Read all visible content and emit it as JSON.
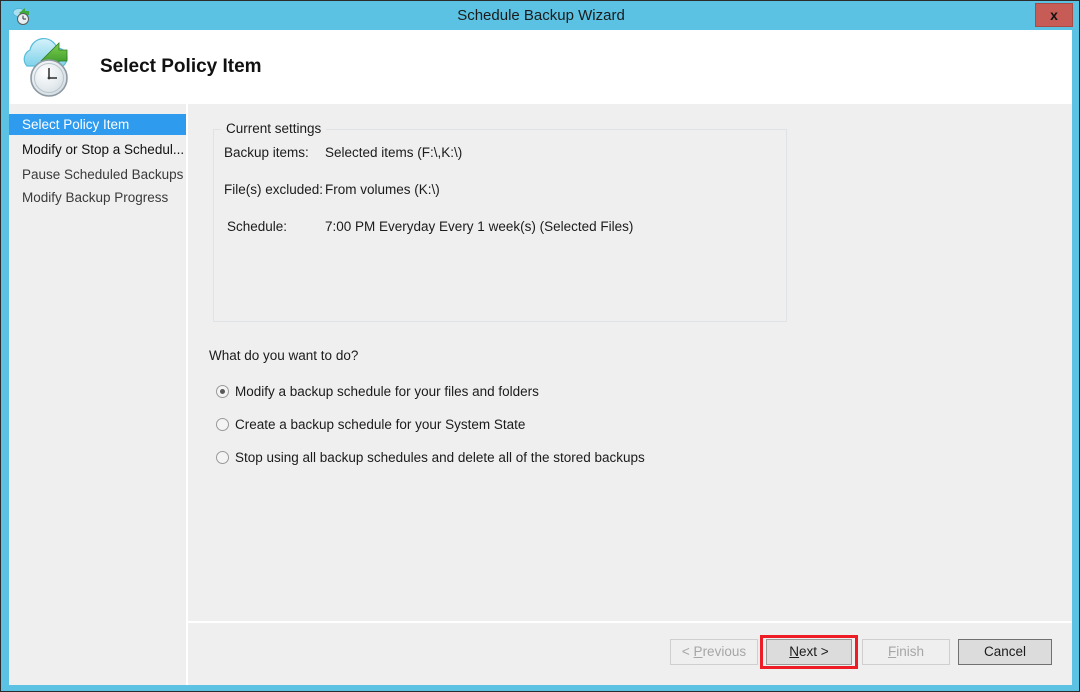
{
  "window": {
    "title": "Schedule Backup Wizard",
    "close_label": "x",
    "titlebar_color": "#5bc2e3",
    "close_color": "#c75b55"
  },
  "header": {
    "title": "Select Policy Item",
    "icon": "cloud-backup-clock-icon"
  },
  "sidebar": {
    "items": [
      {
        "label": "Select Policy Item",
        "selected": true
      },
      {
        "label": "Modify or Stop a Schedul...",
        "selected": false
      },
      {
        "label": "Pause Scheduled Backups",
        "selected": false
      },
      {
        "label": "Modify Backup Progress",
        "selected": false
      }
    ],
    "selected_color": "#2e9bef"
  },
  "current_settings": {
    "legend": "Current settings",
    "rows": [
      {
        "label": "Backup items:",
        "value": "Selected items (F:\\,K:\\)"
      },
      {
        "label": "File(s) excluded:",
        "value": "From volumes (K:\\)"
      },
      {
        "label": "Schedule:",
        "value": "7:00 PM Everyday Every 1 week(s) (Selected Files)"
      }
    ]
  },
  "question": {
    "prompt": "What do you want to do?",
    "options": [
      {
        "label": "Modify a backup schedule for your files and folders",
        "checked": true
      },
      {
        "label": "Create a backup schedule for your System State",
        "checked": false
      },
      {
        "label": "Stop using all backup schedules and delete all of the stored backups",
        "checked": false
      }
    ]
  },
  "footer": {
    "previous": {
      "prefix": "< ",
      "accel": "P",
      "rest": "revious",
      "disabled": true
    },
    "next": {
      "prefix": "",
      "accel": "N",
      "rest": "ext >",
      "disabled": false,
      "highlighted": true
    },
    "finish": {
      "prefix": "",
      "accel": "F",
      "rest": "inish",
      "disabled": true
    },
    "cancel": {
      "label": "Cancel",
      "disabled": false
    },
    "highlight_color": "#ee1c25"
  }
}
